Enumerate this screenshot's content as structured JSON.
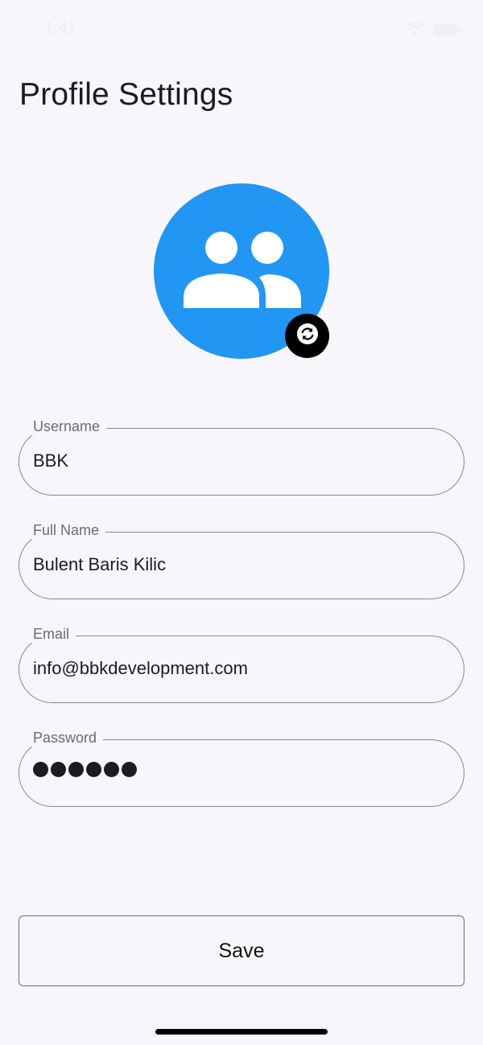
{
  "status_bar": {
    "time": "1:41",
    "icons": [
      "wifi-icon",
      "battery-icon"
    ]
  },
  "page": {
    "title": "Profile Settings"
  },
  "avatar": {
    "icon": "group-icon",
    "background_color": "#2196f3",
    "change_button_icon": "sync-icon"
  },
  "form": {
    "username": {
      "label": "Username",
      "value": "BBK"
    },
    "full_name": {
      "label": "Full Name",
      "value": "Bulent Baris Kilic"
    },
    "email": {
      "label": "Email",
      "value": "info@bbkdevelopment.com"
    },
    "password": {
      "label": "Password",
      "masked_length": 6
    }
  },
  "actions": {
    "save_label": "Save"
  }
}
